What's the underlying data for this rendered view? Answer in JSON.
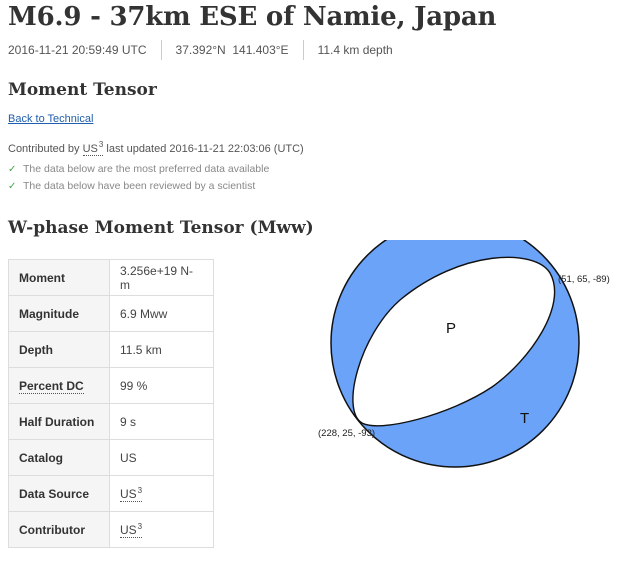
{
  "event": {
    "title": "M6.9 - 37km ESE of Namie, Japan",
    "time": "2016-11-21 20:59:49 UTC",
    "location": "37.392°N  141.403°E",
    "depth": "11.4 km depth"
  },
  "section": {
    "title": "Moment Tensor",
    "back_link": "Back to Technical",
    "contributed_prefix": "Contributed by",
    "contributor": "US",
    "contributor_sup": "3",
    "updated": "last updated 2016-11-21 22:03:06 (UTC)",
    "status": [
      "The data below are the most preferred data available",
      "The data below have been reviewed by a scientist"
    ]
  },
  "tensor": {
    "title": "W-phase Moment Tensor (Mww)",
    "rows": [
      {
        "label": "Moment",
        "value": "3.256e+19 N-m"
      },
      {
        "label": "Magnitude",
        "value": "6.9 Mww"
      },
      {
        "label": "Depth",
        "value": "11.5 km"
      },
      {
        "label": "Percent DC",
        "value": "99 %"
      },
      {
        "label": "Half Duration",
        "value": "9 s"
      },
      {
        "label": "Catalog",
        "value": "US"
      },
      {
        "label": "Data Source",
        "value": "US",
        "sup": "3"
      },
      {
        "label": "Contributor",
        "value": "US",
        "sup": "3"
      }
    ]
  },
  "beachball": {
    "np1": "(51, 65, -89)",
    "np2": "(228, 25, -93)",
    "p_label": "P",
    "t_label": "T",
    "compression_color": "#6aa3f7",
    "dilatation_color": "#ffffff",
    "outline_color": "#111111"
  }
}
